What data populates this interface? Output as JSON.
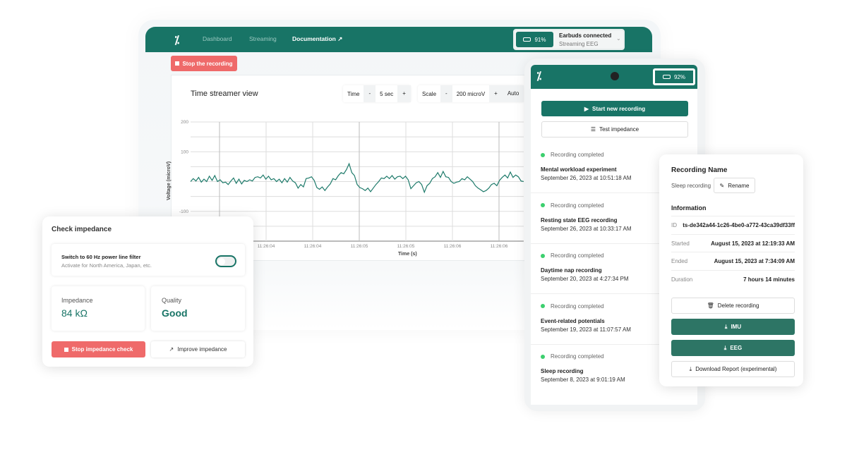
{
  "colors": {
    "brand": "#187466",
    "danger": "#ef6a6a",
    "success": "#3ccf6e",
    "trace": "#1d7a6a"
  },
  "main": {
    "nav": [
      "Dashboard",
      "Streaming",
      "Documentation"
    ],
    "battery": "91%",
    "status_title": "Earbuds connected",
    "status_sub": "Streaming EEG",
    "stop_label": "Stop the recording",
    "chart_title": "Time streamer view",
    "time_label": "Time",
    "time_value": "5 sec",
    "scale_label": "Scale",
    "scale_value": "200 microV",
    "auto_label": "Auto",
    "minus": "-",
    "plus": "+"
  },
  "chart_data": {
    "type": "line",
    "xlabel": "Time (s)",
    "ylabel": "Voltage (microV)",
    "ylim": [
      -200,
      200
    ],
    "yticks": [
      200,
      100,
      -100
    ],
    "ytick_labels": [
      "200",
      "100",
      "-100"
    ],
    "xtick_labels": [
      "11:26:04",
      "11:26:04",
      "11:26:05",
      "11:26:05",
      "11:26:06",
      "11:26:06"
    ],
    "grid": true,
    "series": [
      {
        "values": [
          0,
          10,
          2,
          14,
          -2,
          8,
          0,
          18,
          4,
          20,
          0,
          6,
          -4,
          -2,
          -10,
          2,
          12,
          -6,
          8,
          -8,
          4,
          0,
          6,
          2,
          14,
          16,
          12,
          22,
          8,
          18,
          6,
          10,
          0,
          8,
          -4,
          10,
          -2,
          14,
          2,
          -4,
          -22,
          -10,
          -18,
          10,
          12,
          16,
          4,
          -20,
          -26,
          -18,
          -30,
          -18,
          -8,
          10,
          6,
          20,
          30,
          26,
          40,
          60,
          30,
          20,
          -10,
          -20,
          -24,
          -30,
          -22,
          -34,
          -22,
          -10,
          0,
          12,
          10,
          18,
          10,
          20,
          8,
          16,
          18,
          10,
          18,
          6,
          -24,
          -14,
          -4,
          0,
          -10,
          -36,
          -14,
          -6,
          10,
          16,
          30,
          14,
          34,
          16,
          14,
          0,
          -6,
          -2,
          0,
          10,
          6,
          16,
          8,
          0,
          -14,
          -22,
          -28,
          -34,
          -30,
          -22,
          -10,
          -6,
          -14,
          4,
          14,
          22,
          12,
          32,
          14,
          22,
          16,
          2,
          0
        ]
      }
    ]
  },
  "phone": {
    "battery": "92%",
    "start_label": "Start new recording",
    "impedance_label": "Test impedance",
    "recordings": [
      {
        "status": "Recording completed",
        "name": "Mental workload experiment",
        "date": "September 26, 2023 at 10:51:18 AM"
      },
      {
        "status": "Recording completed",
        "name": "Resting state EEG recording",
        "date": "September 26, 2023 at 10:33:17 AM"
      },
      {
        "status": "Recording completed",
        "name": "Daytime nap recording",
        "date": "September 20, 2023 at 4:27:34 PM"
      },
      {
        "status": "Recording completed",
        "name": "Event-related potentials",
        "date": "September 19, 2023 at 11:07:57 AM"
      },
      {
        "status": "Recording completed",
        "name": "Sleep recording",
        "date": "September 8, 2023 at 9:01:19 AM"
      }
    ]
  },
  "detail": {
    "title": "Recording Name",
    "name": "Sleep recording",
    "rename": "Rename",
    "info_title": "Information",
    "rows": [
      {
        "k": "ID",
        "v": "ts-de342a44-1c26-4be0-a772-43ca39df33ff"
      },
      {
        "k": "Started",
        "v": "August 15, 2023 at 12:19:33 AM"
      },
      {
        "k": "Ended",
        "v": "August 15, 2023 at 7:34:09 AM"
      },
      {
        "k": "Duration",
        "v": "7 hours 14 minutes"
      }
    ],
    "delete": "Delete recording",
    "imu": "IMU",
    "eeg": "EEG",
    "report": "Download Report (experimental)"
  },
  "impedance": {
    "title": "Check impedance",
    "filter_title": "Switch to 60 Hz power line filter",
    "filter_sub": "Activate for North America, Japan, etc.",
    "filter_on": false,
    "imp_label": "Impedance",
    "imp_value": "84 kΩ",
    "quality_label": "Quality",
    "quality_value": "Good",
    "stop": "Stop impedance check",
    "improve": "Improve impedance"
  }
}
